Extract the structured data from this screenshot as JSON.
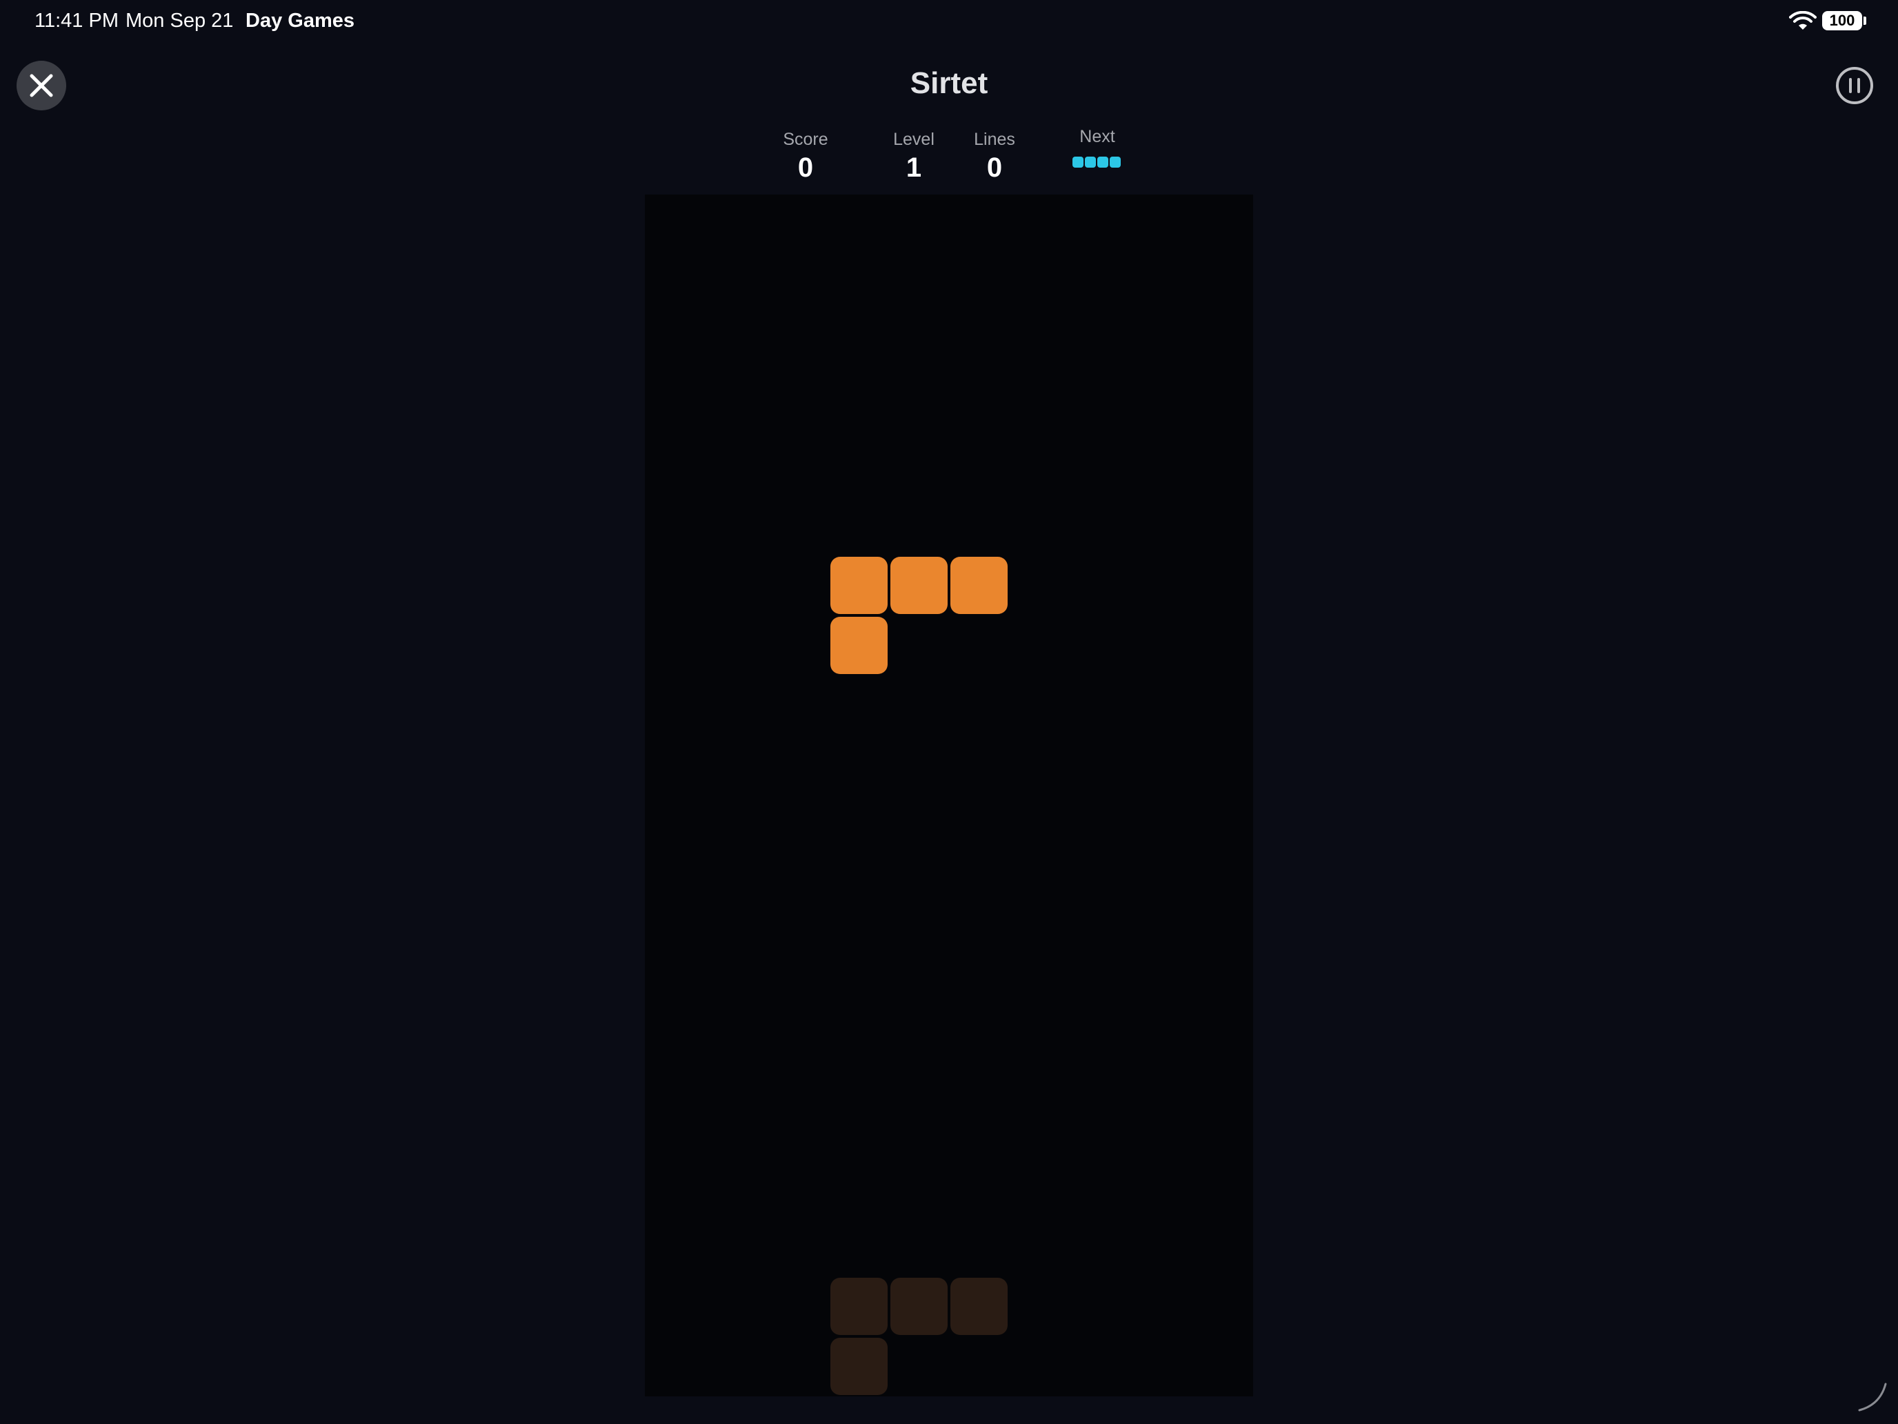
{
  "status_bar": {
    "time": "11:41 PM",
    "date": "Mon Sep 21",
    "app_name": "Day Games",
    "battery": "100",
    "icons": [
      "wifi-icon",
      "battery-icon"
    ]
  },
  "header": {
    "title": "Sirtet",
    "close_icon": "close-icon",
    "pause_icon": "pause-icon"
  },
  "stats": {
    "score_label": "Score",
    "score": "0",
    "level_label": "Level",
    "level": "1",
    "lines_label": "Lines",
    "lines": "0",
    "next_label": "Next",
    "next_piece": "I",
    "next_piece_color": "#2cc7e6"
  },
  "board": {
    "active_piece": "L",
    "active_color": "#ea862e",
    "ghost_color": "#2a1c14",
    "background": "#040508"
  },
  "colors": {
    "page_background": "#0a0c15",
    "title": "#e2e3e6",
    "label": "#a5a7ad"
  }
}
